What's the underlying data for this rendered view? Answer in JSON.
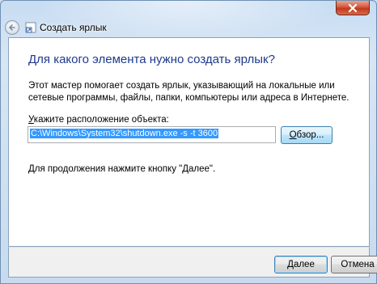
{
  "window": {
    "title": "Создать ярлык"
  },
  "main": {
    "heading": "Для какого элемента нужно создать ярлык?",
    "description": "Этот мастер помогает создать ярлык, указывающий на локальные или сетевые программы, файлы, папки, компьютеры или адреса в Интернете.",
    "location_label_accel": "У",
    "location_label_rest": "кажите расположение объекта:",
    "location_value": "C:\\Windows\\System32\\shutdown.exe -s -t 3600",
    "browse_accel": "О",
    "browse_rest": "бзор...",
    "hint": "Для продолжения нажмите кнопку \"Далее\"."
  },
  "footer": {
    "next_accel": "Д",
    "next_rest": "алее",
    "cancel_label": "Отмена"
  },
  "colors": {
    "heading": "#1e3a8c",
    "selection": "#3399ff",
    "close_button": "#c0391b"
  },
  "icons": {
    "close": "close-icon",
    "back": "back-arrow-icon",
    "app": "shortcut-wizard-icon"
  }
}
